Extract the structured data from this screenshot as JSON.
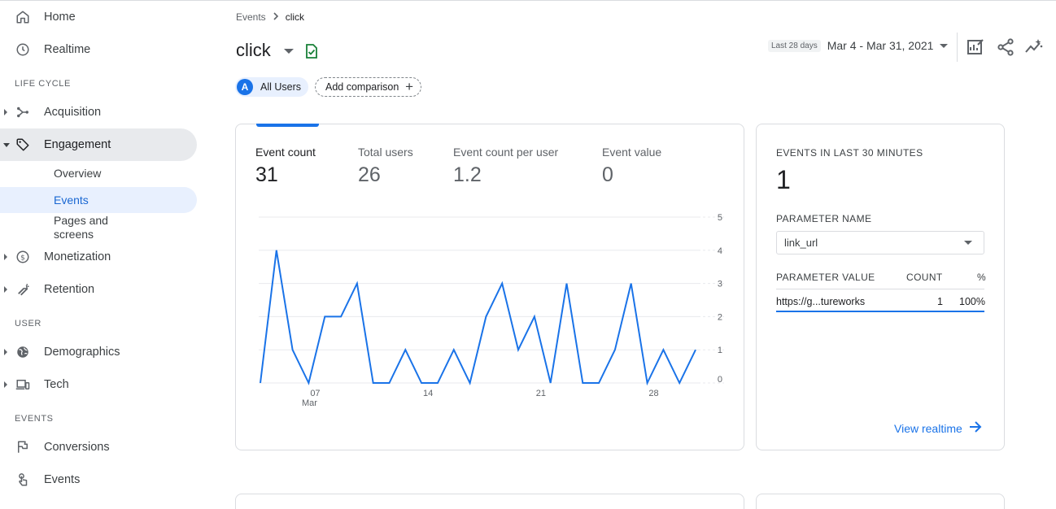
{
  "sidebar": {
    "home": "Home",
    "realtime": "Realtime",
    "section_lifecycle": "LIFE CYCLE",
    "acquisition": "Acquisition",
    "engagement": "Engagement",
    "overview": "Overview",
    "events": "Events",
    "pages_line1": "Pages and",
    "pages_line2": "screens",
    "monetization": "Monetization",
    "retention": "Retention",
    "section_user": "USER",
    "demographics": "Demographics",
    "tech": "Tech",
    "section_events": "EVENTS",
    "conversions": "Conversions",
    "events_bottom": "Events"
  },
  "header": {
    "breadcrumb_parent": "Events",
    "breadcrumb_current": "click",
    "title": "click",
    "segment_avatar": "A",
    "segment_label": "All Users",
    "add_comparison": "Add comparison",
    "date_small": "Last 28 days",
    "date_range": "Mar 4 - Mar 31, 2021"
  },
  "metrics": [
    {
      "label": "Event count",
      "value": "31"
    },
    {
      "label": "Total users",
      "value": "26"
    },
    {
      "label": "Event count per user",
      "value": "1.2"
    },
    {
      "label": "Event value",
      "value": "0"
    }
  ],
  "chart_data": {
    "type": "line",
    "x_tick_labels": [
      "07",
      "14",
      "21",
      "28"
    ],
    "x_sublabel": "Mar",
    "y_ticks": [
      0,
      1,
      2,
      3,
      4,
      5
    ],
    "ylim": [
      0,
      5
    ],
    "series": [
      {
        "values": [
          0,
          4,
          1,
          0,
          2,
          2,
          3,
          0,
          0,
          1,
          0,
          0,
          1,
          0,
          2,
          3,
          1,
          2,
          0,
          3,
          0,
          0,
          1,
          3,
          0,
          1,
          0,
          1
        ]
      }
    ],
    "color": "#1a73e8",
    "grid": true
  },
  "realtime": {
    "title": "EVENTS IN LAST 30 MINUTES",
    "count": "1",
    "param_label": "PARAMETER NAME",
    "param_value": "link_url",
    "col_value": "PARAMETER VALUE",
    "col_count": "COUNT",
    "col_pct": "%",
    "row_value": "https://g...tureworks",
    "row_count": "1",
    "row_pct": "100%",
    "link": "View realtime"
  },
  "colors": {
    "accent": "#1a73e8",
    "check": "#188038"
  }
}
